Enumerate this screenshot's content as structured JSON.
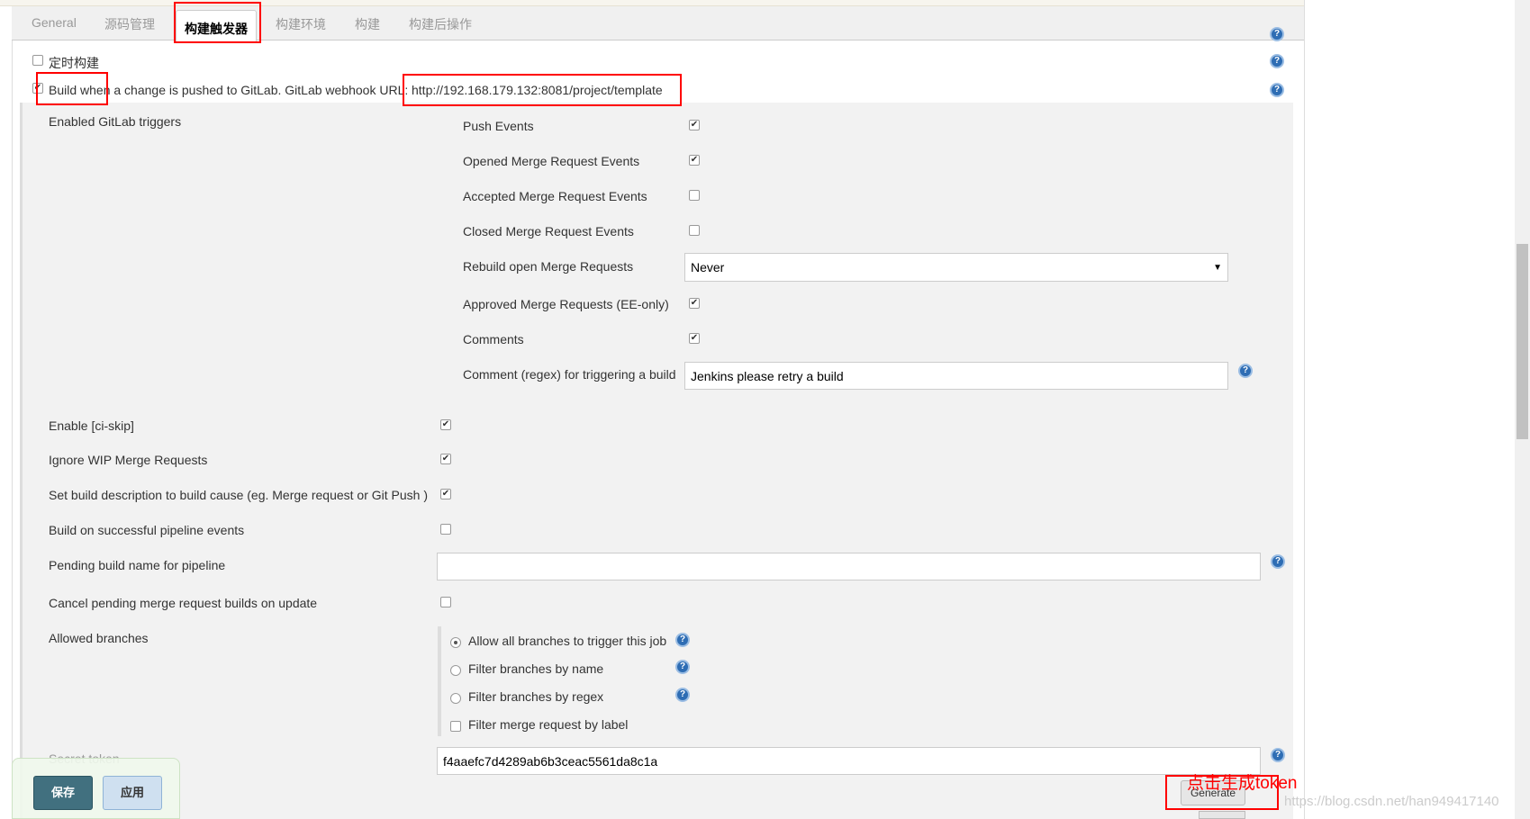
{
  "tabs": [
    "General",
    "源码管理",
    "构建触发器",
    "构建环境",
    "构建",
    "构建后操作"
  ],
  "active_tab": "构建触发器",
  "triggers": {
    "timed_build": {
      "label": "定时构建",
      "checked": false
    },
    "gitlab": {
      "label": "Build when a change is pushed to GitLab. GitLab webhook URL:",
      "url": "http://192.168.179.132:8081/project/template",
      "checked": true
    }
  },
  "gitlab_triggers": {
    "label": "Enabled GitLab triggers",
    "items": [
      {
        "label": "Push Events",
        "checked": true
      },
      {
        "label": "Opened Merge Request Events",
        "checked": true
      },
      {
        "label": "Accepted Merge Request Events",
        "checked": false
      },
      {
        "label": "Closed Merge Request Events",
        "checked": false
      }
    ],
    "rebuild": {
      "label": "Rebuild open Merge Requests",
      "value": "Never"
    },
    "items2": [
      {
        "label": "Approved Merge Requests (EE-only)",
        "checked": true
      },
      {
        "label": "Comments",
        "checked": true
      }
    ],
    "comment_regex": {
      "label": "Comment (regex) for triggering a build",
      "value": "Jenkins please retry a build"
    }
  },
  "options": [
    {
      "label": "Enable [ci-skip]",
      "checked": true
    },
    {
      "label": "Ignore WIP Merge Requests",
      "checked": true
    },
    {
      "label": "Set build description to build cause (eg. Merge request or Git Push )",
      "checked": true
    },
    {
      "label": "Build on successful pipeline events",
      "checked": false
    }
  ],
  "pending_build": {
    "label": "Pending build name for pipeline",
    "value": ""
  },
  "cancel_pending": {
    "label": "Cancel pending merge request builds on update",
    "checked": false
  },
  "branches": {
    "label": "Allowed branches",
    "radios": [
      {
        "label": "Allow all branches to trigger this job",
        "selected": true
      },
      {
        "label": "Filter branches by name",
        "selected": false
      },
      {
        "label": "Filter branches by regex",
        "selected": false
      }
    ],
    "filter_label": {
      "label": "Filter merge request by label",
      "checked": false
    }
  },
  "secret_token": {
    "label": "Secret token",
    "value": "f4aaefc7d4289ab6b3ceac5561da8c1a"
  },
  "generate_label": "Generate",
  "annotation": "点击生成token",
  "buttons": {
    "save": "保存",
    "apply": "应用"
  },
  "watermark": "https://blog.csdn.net/han949417140",
  "colors": {
    "save": "#41707f",
    "apply": "#cfe0f0",
    "highlight": "#ff0000",
    "help": "#2e6db4"
  }
}
